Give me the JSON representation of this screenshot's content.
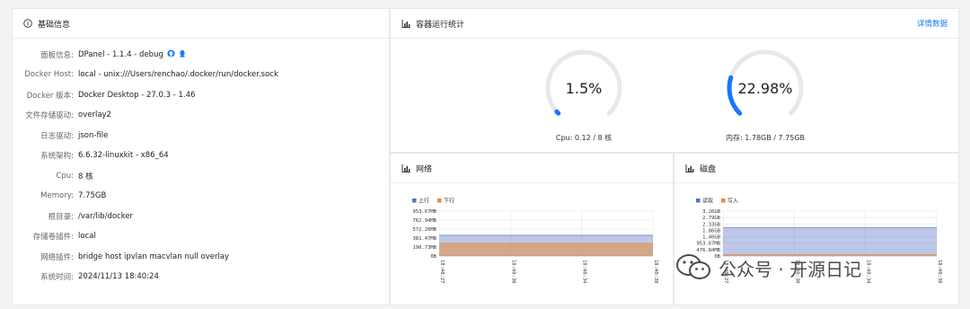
{
  "basic": {
    "title": "基础信息",
    "rows": [
      {
        "label": "面板信息:",
        "value": "DPanel - 1.1.4 - debug"
      },
      {
        "label": "Docker Host:",
        "value": "local - unix:///Users/renchao/.docker/run/docker.sock"
      },
      {
        "label": "Docker 版本:",
        "value": "Docker Desktop - 27.0.3 - 1.46"
      },
      {
        "label": "文件存储驱动:",
        "value": "overlay2"
      },
      {
        "label": "日志驱动:",
        "value": "json-file"
      },
      {
        "label": "系统架构:",
        "value": "6.6.32-linuxkit - x86_64"
      },
      {
        "label": "Cpu:",
        "value": "8 核"
      },
      {
        "label": "Memory:",
        "value": "7.75GB"
      },
      {
        "label": "根目录:",
        "value": "/var/lib/docker"
      },
      {
        "label": "存储卷插件:",
        "value": "local"
      },
      {
        "label": "网络插件:",
        "value": "bridge  host  ipvlan  macvlan  null  overlay"
      },
      {
        "label": "系统时间:",
        "value": "2024/11/13 18:40:24"
      }
    ]
  },
  "stats": {
    "title": "容器运行统计",
    "detail_link": "详情数据",
    "cpu": {
      "value_text": "1.5%",
      "percent": 1.5,
      "caption": "Cpu: 0.12 / 8 核"
    },
    "memory": {
      "value_text": "22.98%",
      "percent": 22.98,
      "caption": "内存: 1.78GB / 7.75GB"
    }
  },
  "network": {
    "title": "网络"
  },
  "disk": {
    "title": "磁盘"
  },
  "chart_data": [
    {
      "type": "area",
      "series": [
        {
          "name": "上行",
          "color": "#5470c6",
          "values": [
            440,
            440,
            440,
            440,
            440
          ]
        },
        {
          "name": "下行",
          "color": "#e88a3a",
          "values": [
            272,
            272,
            272,
            272,
            272
          ]
        }
      ],
      "x": [
        "18:40:27",
        "18:40:30",
        "18:40:34",
        "18:40:38"
      ],
      "y_ticks": [
        "953.67MB",
        "762.94MB",
        "572.20MB",
        "381.47MB",
        "190.73MB",
        "0B"
      ],
      "ylim": [
        0,
        953.67
      ],
      "grid": true,
      "legend": "top-left"
    },
    {
      "type": "area",
      "series": [
        {
          "name": "读取",
          "color": "#5470c6",
          "values": [
            2.07,
            2.07,
            2.07,
            2.07,
            2.07
          ]
        },
        {
          "name": "写入",
          "color": "#e88a3a",
          "values": [
            0.1,
            0.1,
            0.1,
            0.1,
            0.1
          ]
        }
      ],
      "x": [
        "18:40:27",
        "18:40:30",
        "18:40:34",
        "18:40:38"
      ],
      "y_ticks": [
        "3.26GB",
        "2.79GB",
        "2.33GB",
        "1.86GB",
        "1.40GB",
        "953.67MB",
        "476.84MB",
        "0B"
      ],
      "ylim": [
        0,
        3.26
      ],
      "grid": true,
      "legend": "top-left"
    }
  ],
  "watermark": {
    "text": "公众号 · 开源日记"
  },
  "colors": {
    "accent": "#1677ff",
    "track": "#e8e8ec"
  }
}
